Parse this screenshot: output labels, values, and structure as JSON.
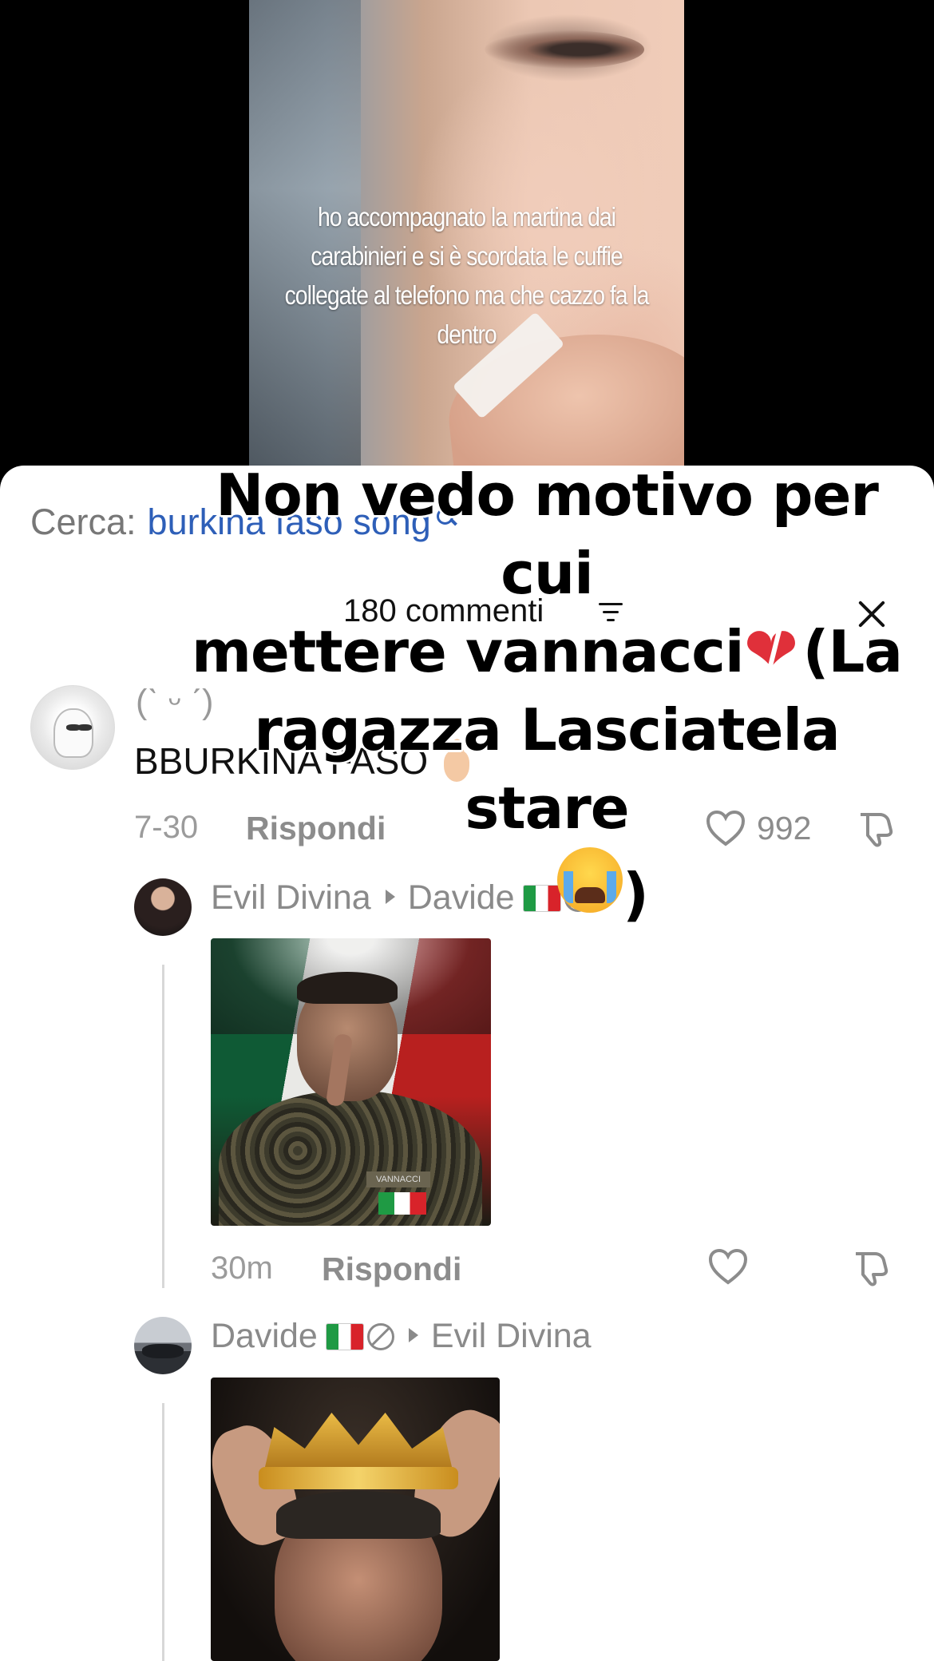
{
  "video": {
    "caption": "ho accompagnato la martina dai carabinieri e si è scordata le cuffie collegate al telefono ma che cazzo fa la dentro"
  },
  "overlay": {
    "line1": "Non vedo motivo per cui",
    "line2_text": "mettere vannacci",
    "line2_after": "(La",
    "line3": "ragazza Lasciatela stare",
    "line4_close": ")"
  },
  "search": {
    "label": "Cerca:",
    "query": "burkina faso song"
  },
  "comments_header": {
    "count": "180 commenti"
  },
  "comments": [
    {
      "username": "(ˋ ᵕ ˊ)",
      "text": "BBURKINA FASO",
      "date": "7-30",
      "reply": "Rispondi",
      "likes": "992"
    }
  ],
  "replies": [
    {
      "username": "Evil Divina",
      "reply_to": "Davide",
      "date": "30m",
      "reply": "Rispondi",
      "image_text": "VANNACCI"
    },
    {
      "username": "Davide",
      "reply_to": "Evil Divina"
    }
  ]
}
